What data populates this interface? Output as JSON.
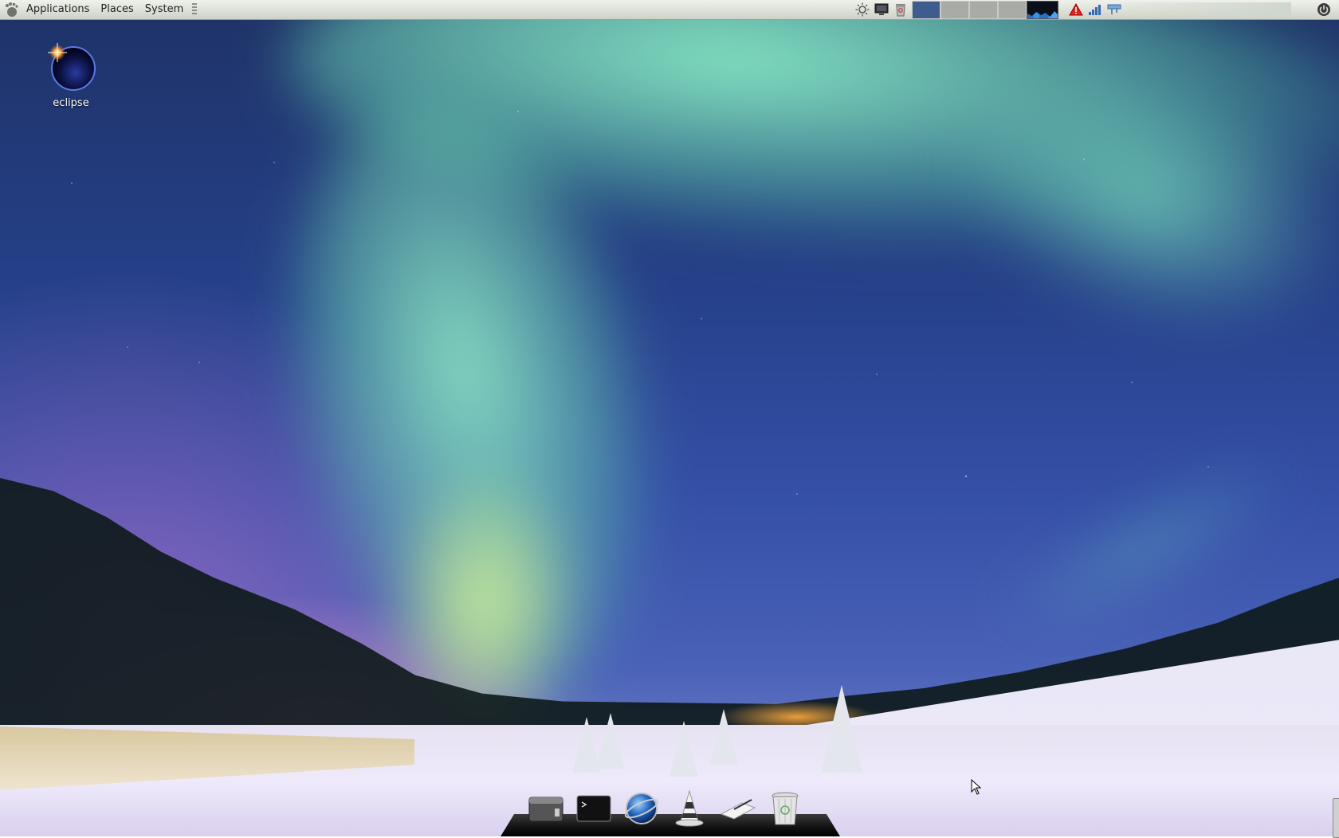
{
  "panel": {
    "menus": [
      {
        "label": "Applications"
      },
      {
        "label": "Places"
      },
      {
        "label": "System"
      }
    ],
    "tray_icons": [
      "brightness-applet-icon",
      "screen-icon",
      "trash-panel-icon"
    ],
    "workspaces": {
      "count": 4,
      "active_index": 0
    },
    "status_icons": [
      "warning-icon",
      "network-signal-icon",
      "network-wired-icon"
    ],
    "colors": {
      "panel_bg": "#dcdfd6",
      "workspace_active": "#3e5d8e",
      "workspace_inactive": "#a8aba6"
    }
  },
  "desktop": {
    "icons": [
      {
        "label": "eclipse",
        "icon": "eclipse-icon"
      }
    ]
  },
  "dock": {
    "items": [
      {
        "icon": "file-manager-icon"
      },
      {
        "icon": "terminal-icon"
      },
      {
        "icon": "web-browser-icon"
      },
      {
        "icon": "vlc-icon"
      },
      {
        "icon": "text-editor-icon"
      },
      {
        "icon": "trash-icon"
      }
    ]
  }
}
